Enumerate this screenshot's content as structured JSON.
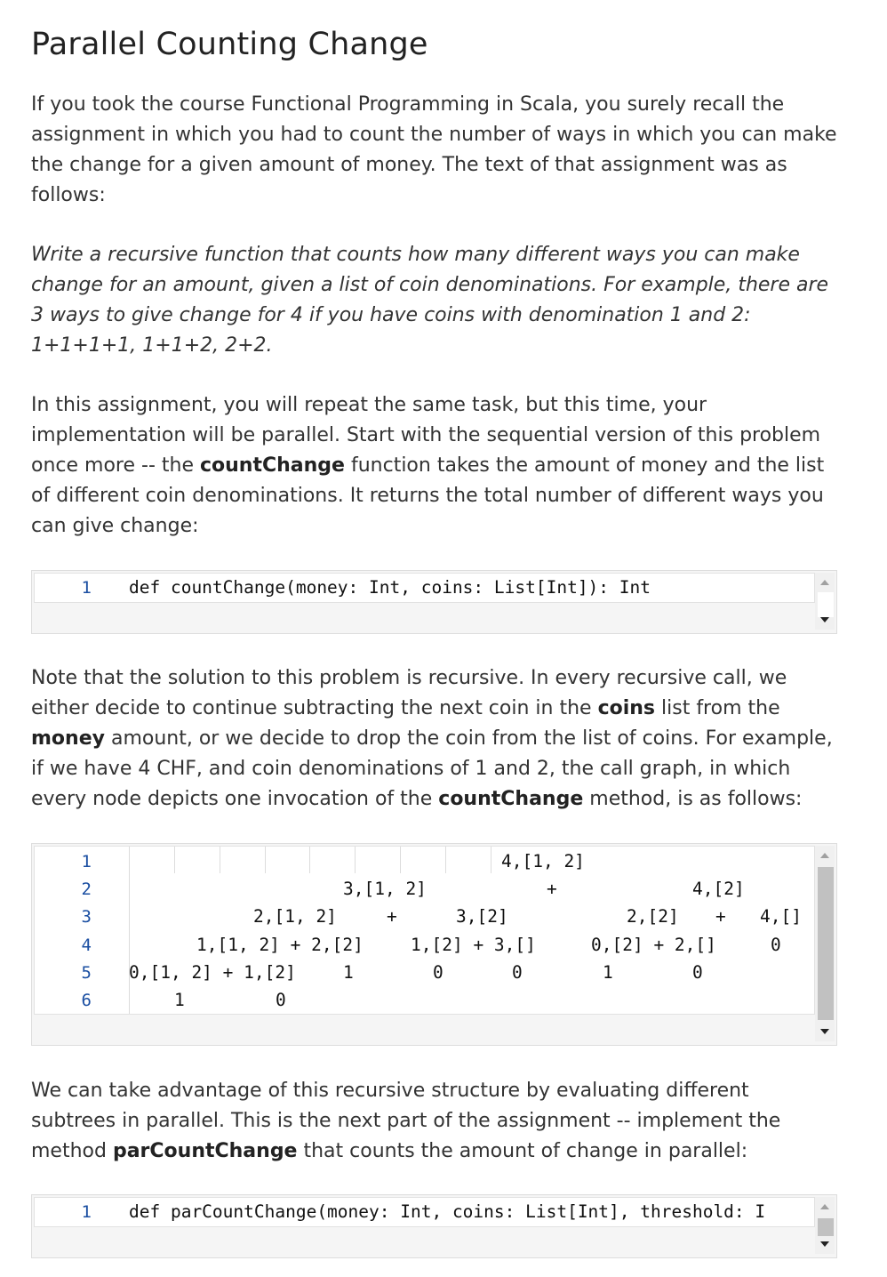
{
  "title": "Parallel Counting Change",
  "intro": "If you took the course Functional Programming in Scala, you surely recall the assignment in which you had to count the number of ways in which you can make the change for a given amount of money. The text of that assignment was as follows:",
  "quote": "Write a recursive function that counts how many different ways you can make change for an amount, given a list of coin denominations. For example, there are 3 ways to give change for 4 if you have coins with denomination 1 and 2: 1+1+1+1, 1+1+2, 2+2.",
  "task": {
    "before": "In this assignment, you will repeat the same task, but this time, your implementation will be parallel. Start with the sequential version of this problem once more -- the ",
    "bold": "countChange",
    "after": " function takes the amount of money and the list of different coin denominations. It returns the total number of different ways you can give change:"
  },
  "code1": {
    "line_number": "1",
    "text": "def countChange(money: Int, coins: List[Int]): Int"
  },
  "note": {
    "p1": "Note that the solution to this problem is recursive. In every recursive call, we either decide to continue subtracting the next coin in the ",
    "b1": "coins",
    "p2": " list from the ",
    "b2": "money",
    "p3": " amount, or we decide to drop the coin from the list of coins. For example, if we have 4 CHF, and coin denominations of 1 and 2, the call graph, in which every node depicts one invocation of the ",
    "b3": "countChange",
    "p4": " method, is as follows:"
  },
  "graph": {
    "line_numbers": [
      "1",
      "2",
      "3",
      "4",
      "5",
      "6"
    ],
    "row1": [
      "4,[1, 2]"
    ],
    "row2": [
      "3,[1, 2]",
      "+",
      "4,[2]"
    ],
    "row3": [
      "2,[1, 2]",
      "+",
      "3,[2]",
      "2,[2]",
      "+",
      "4,[]"
    ],
    "row4": [
      "1,[1, 2] + 2,[2]",
      "1,[2] + 3,[]",
      "0,[2] + 2,[]",
      "0"
    ],
    "row5": [
      "0,[1, 2] + 1,[2]",
      "1",
      "0",
      "0",
      "1",
      "0"
    ],
    "row6": [
      "1",
      "0"
    ]
  },
  "advantage": {
    "p1": "We can take advantage of this recursive structure by evaluating different subtrees in parallel. This is the next part of the assignment -- implement the method ",
    "b1": "parCountChange",
    "p2": " that counts the amount of change in parallel:"
  },
  "code2": {
    "line_number": "1",
    "text": "def parCountChange(money: Int, coins: List[Int], threshold: I"
  }
}
